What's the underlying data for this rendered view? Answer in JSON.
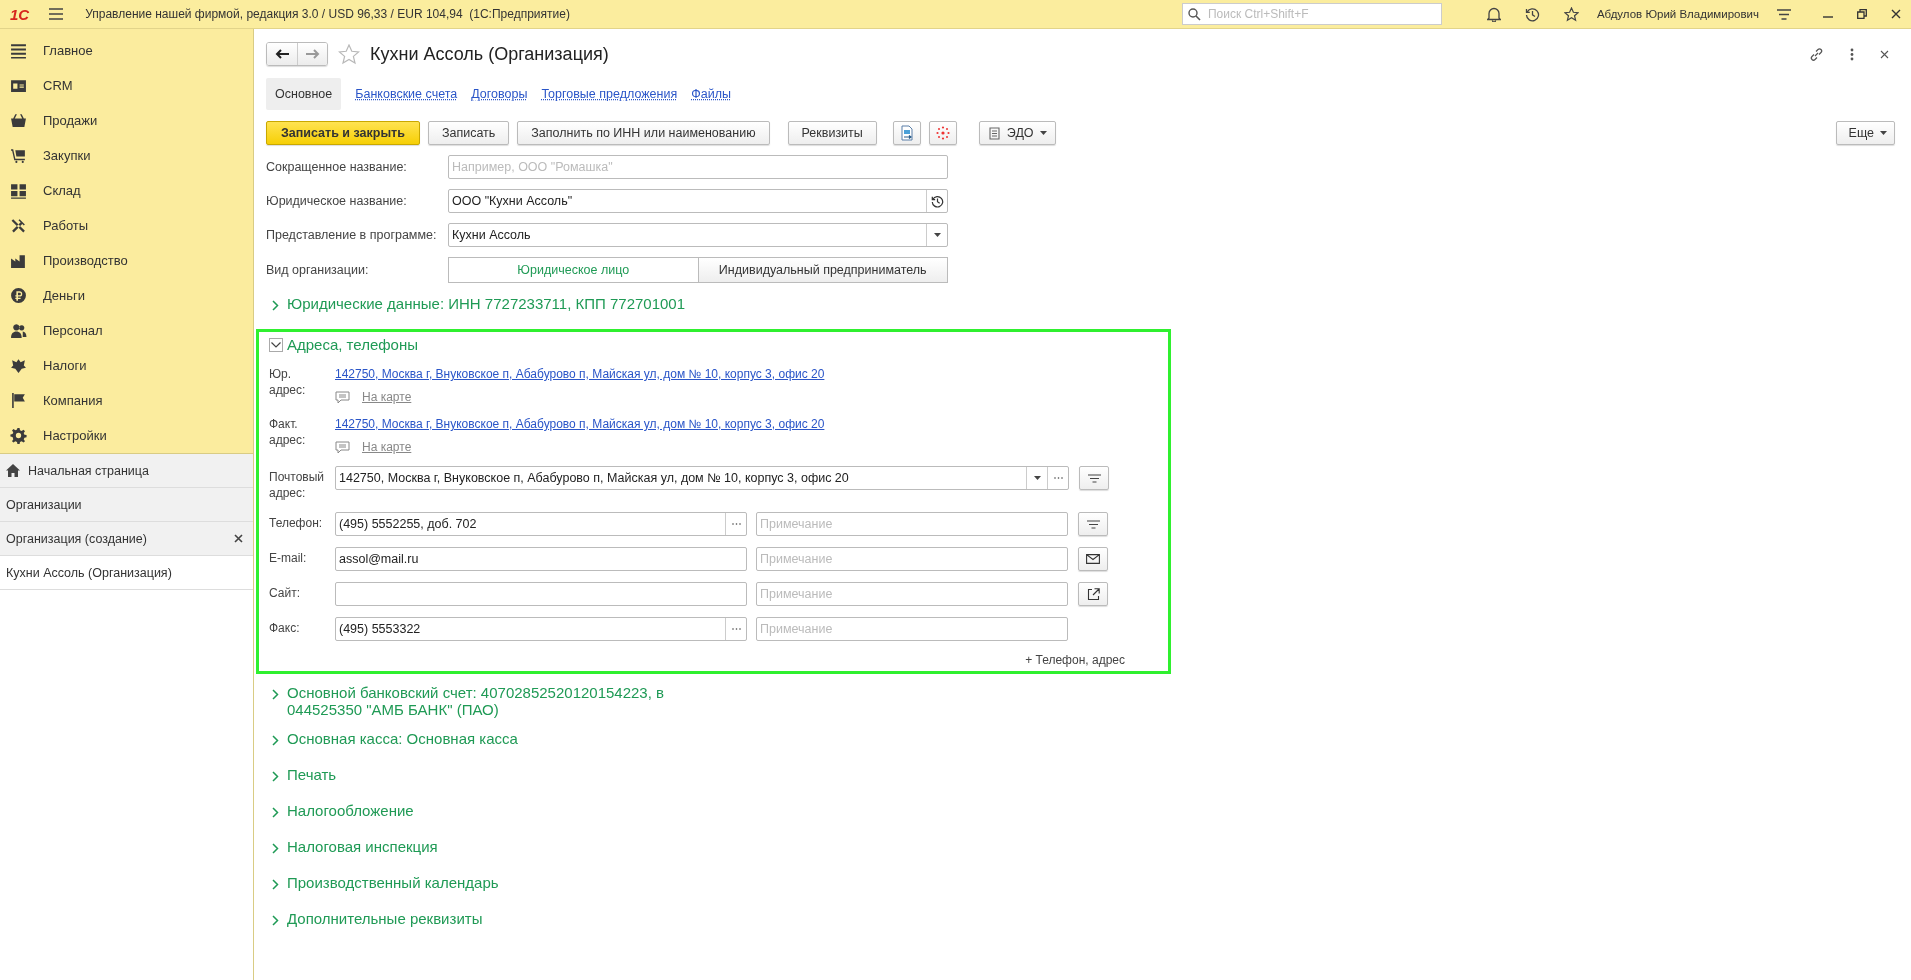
{
  "app_bar": {
    "logo": "1С",
    "title": "Управление нашей фирмой, редакция 3.0 / USD 96,33 / EUR 104,94  (1С:Предприятие)",
    "search_placeholder": "Поиск Ctrl+Shift+F",
    "user": "Абдулов Юрий Владимирович"
  },
  "sidebar": {
    "sections": [
      {
        "label": "Главное",
        "selected": false
      },
      {
        "label": "CRM",
        "selected": false
      },
      {
        "label": "Продажи",
        "selected": false
      },
      {
        "label": "Закупки",
        "selected": false
      },
      {
        "label": "Склад",
        "selected": false
      },
      {
        "label": "Работы",
        "selected": false
      },
      {
        "label": "Производство",
        "selected": false
      },
      {
        "label": "Деньги",
        "selected": false
      },
      {
        "label": "Персонал",
        "selected": false
      },
      {
        "label": "Налоги",
        "selected": false
      },
      {
        "label": "Компания",
        "selected": false
      },
      {
        "label": "Настройки",
        "selected": false
      }
    ],
    "windows": [
      {
        "label": "Начальная страница",
        "selected": false,
        "closable": false
      },
      {
        "label": "Организации",
        "selected": false,
        "closable": false
      },
      {
        "label": "Организация (создание)",
        "selected": false,
        "closable": true
      },
      {
        "label": "Кухни Ассоль (Организация)",
        "selected": true,
        "closable": false
      }
    ]
  },
  "form": {
    "title": "Кухни Ассоль (Организация)",
    "favorite": false,
    "tabs": [
      {
        "label": "Основное",
        "selected": true
      },
      {
        "label": "Банковские счета",
        "selected": false
      },
      {
        "label": "Договоры",
        "selected": false
      },
      {
        "label": "Торговые предложения",
        "selected": false
      },
      {
        "label": "Файлы",
        "selected": false
      }
    ],
    "toolbar": {
      "buttons": [
        {
          "label": "Записать и закрыть",
          "kind": "primary"
        },
        {
          "label": "Записать",
          "kind": "default"
        },
        {
          "label": "Заполнить по ИНН или наименованию",
          "kind": "default"
        },
        {
          "label": "Реквизиты",
          "kind": "default"
        }
      ],
      "edo": "ЭДО",
      "more": "Еще"
    },
    "fields": [
      {
        "label": "Сокращенное название:",
        "kind": "text",
        "placeholder": "Например, ООО \"Ромашка\""
      },
      {
        "label": "Юридическое название:",
        "kind": "history",
        "value": "ООО \"Кухни Ассоль\""
      },
      {
        "label": "Представление в программе:",
        "kind": "dropdown",
        "value": "Кухни Ассоль"
      },
      {
        "label": "Вид организации:",
        "kind": "toggle",
        "options": [
          {
            "label": "Юридическое лицо",
            "selected": true
          },
          {
            "label": "Индивидуальный предприниматель",
            "selected": false
          }
        ]
      }
    ],
    "groups": [
      {
        "label": "Юридические данные: ИНН 7727233711, КПП 772701001",
        "expanded": false
      },
      {
        "label": "Адреса, телефоны",
        "expanded": true,
        "highlighted": true,
        "addresses": [
          {
            "label": "Юр. адрес:",
            "value": "142750, Москва г, Внуковское п, Абабурово п, Майская ул, дом № 10, корпус 3, офис 20",
            "map_link": "На карте"
          },
          {
            "label": "Факт. адрес:",
            "value": "142750, Москва г, Внуковское п, Абабурово п, Майская ул, дом № 10, корпус 3, офис 20",
            "map_link": "На карте"
          }
        ],
        "postal": {
          "label": "Почтовый адрес:",
          "value": "142750, Москва г, Внуковское п, Абабурово п, Майская ул, дом № 10, корпус 3, офис 20"
        },
        "contacts": [
          {
            "kind": "phone",
            "label": "Телефон:",
            "value": "(495) 5552255, доб. 702",
            "note_placeholder": "Примечание"
          },
          {
            "kind": "email",
            "label": "E-mail:",
            "value": "assol@mail.ru",
            "note_placeholder": "Примечание"
          },
          {
            "kind": "site",
            "label": "Сайт:",
            "note_placeholder": "Примечание"
          },
          {
            "kind": "fax",
            "label": "Факс:",
            "value": "(495) 5553322",
            "note_placeholder": "Примечание"
          }
        ],
        "add_link": "+ Телефон, адрес"
      },
      {
        "label": "Основной банковский счет: 40702852520120154223, в 044525350 \"АМБ БАНК\" (ПАО)",
        "expanded": false
      },
      {
        "label": "Основная касса: Основная касса",
        "expanded": false
      },
      {
        "label": "Печать",
        "expanded": false
      },
      {
        "label": "Налогообложение",
        "expanded": false
      },
      {
        "label": "Налоговая инспекция",
        "expanded": false
      },
      {
        "label": "Производственный календарь",
        "expanded": false
      },
      {
        "label": "Дополнительные реквизиты",
        "expanded": false
      }
    ]
  }
}
